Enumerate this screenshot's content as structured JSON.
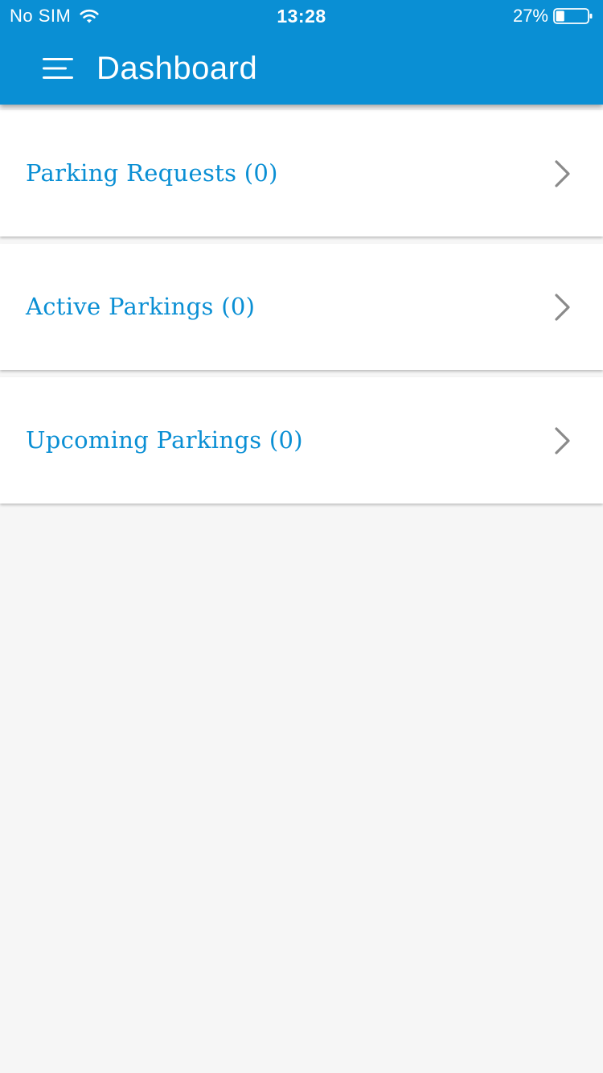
{
  "status_bar": {
    "carrier": "No SIM",
    "time": "13:28",
    "battery_percent": "27%",
    "battery_level": 0.27,
    "wifi_icon": "wifi-icon",
    "battery_icon": "battery-icon"
  },
  "header": {
    "title": "Dashboard",
    "menu_icon": "hamburger-menu-icon",
    "background_color": "#0a8fd4"
  },
  "dashboard": {
    "items": [
      {
        "label": "Parking Requests (0)",
        "icon": "chevron-right-icon"
      },
      {
        "label": "Active Parkings (0)",
        "icon": "chevron-right-icon"
      },
      {
        "label": "Upcoming Parkings (0)",
        "icon": "chevron-right-icon"
      }
    ]
  },
  "colors": {
    "accent": "#0a8fd4",
    "page_background": "#f6f6f6",
    "card_background": "#ffffff",
    "chevron": "#8a8a8a"
  }
}
